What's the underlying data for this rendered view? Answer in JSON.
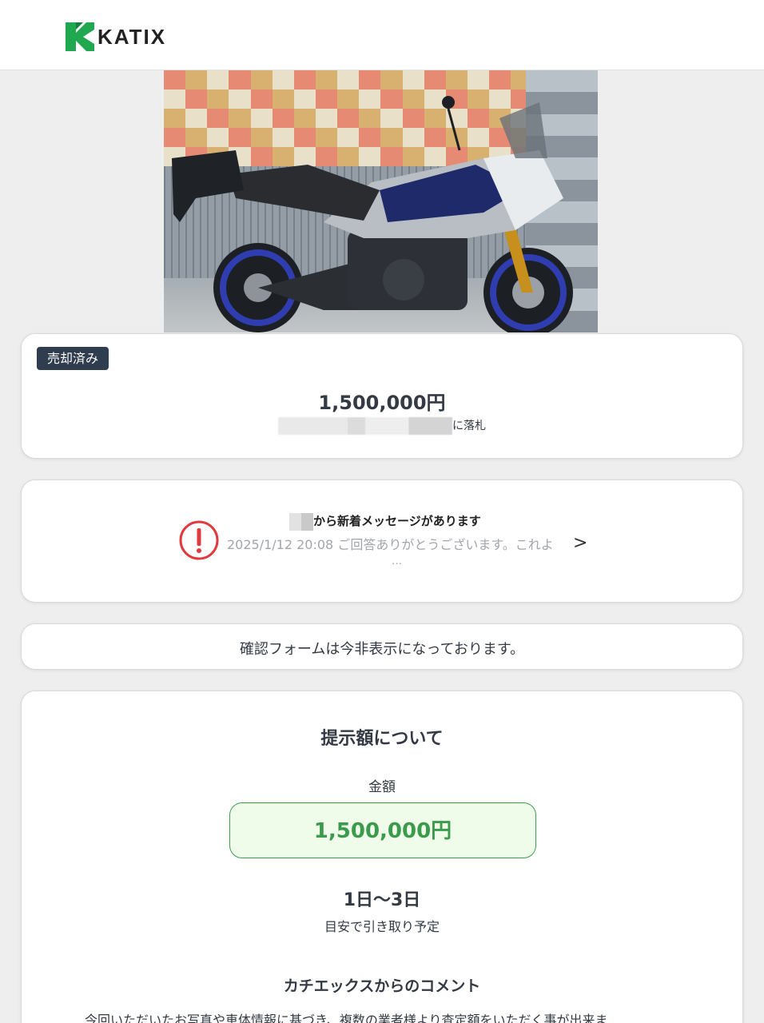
{
  "header": {
    "logo_text": "KATIX",
    "brand_color": "#1fa84f"
  },
  "status": {
    "badge": "売却済み",
    "price": "1,500,000円",
    "winner_suffix": "に落札"
  },
  "message": {
    "title_suffix": "から新着メッセージがあります",
    "preview": "2025/1/12 20:08 ご回答ありがとうございます。これよ",
    "more": "…",
    "chevron": ">",
    "alert_color": "#e03a3e"
  },
  "form_notice": {
    "text": "確認フォームは今非表示になっております。"
  },
  "offer": {
    "title": "提示額について",
    "amount_label": "金額",
    "amount": "1,500,000円",
    "period": "1日〜3日",
    "period_sub": "目安で引き取り予定",
    "comment_title": "カチエックスからのコメント",
    "comment_text": "今回いただいたお写真や車体情報に基づき、複数の業者様より査定額をいただく事が出来ま"
  }
}
